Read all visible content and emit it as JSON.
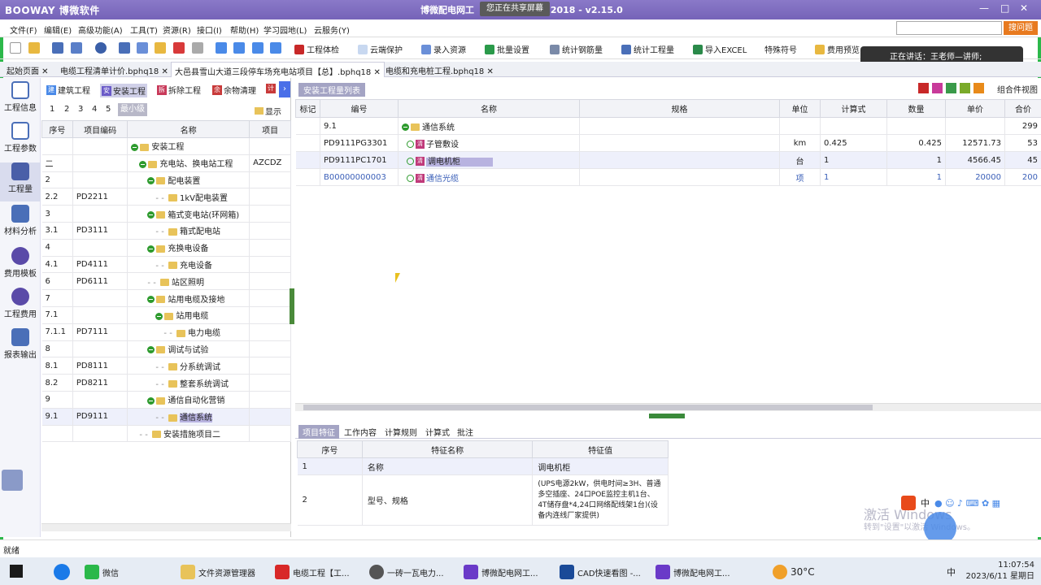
{
  "window": {
    "logo": "BOOWAY 博微软件",
    "title": "博微配电网工",
    "title_suffix": "2018 - v2.15.0",
    "share_notice": "您正在共享屏幕",
    "controls": [
      "—",
      "□",
      "✕"
    ]
  },
  "menu": {
    "items": [
      "文件(F)",
      "编辑(E)",
      "高级功能(A)",
      "工具(T)",
      "资源(R)",
      "接口(I)",
      "帮助(H)",
      "学习园地(L)",
      "云服务(Y)"
    ],
    "search_placeholder": "",
    "ask_label": "搜问题"
  },
  "toolbar": {
    "buttons": [
      "工程体检",
      "云端保护",
      "录入资源",
      "批量设置",
      "统计钢筋量",
      "统计工程量",
      "导入EXCEL",
      "特殊符号",
      "费用预览"
    ],
    "speaking": "正在讲话：王老师—讲师;"
  },
  "doc_tabs": [
    "起始页面",
    "电缆工程清单计价.bphq18",
    "大邑县雪山大道三段停车场充电站项目【总】.bphq18",
    "电缆和充电桩工程.bphq18"
  ],
  "left_nav": [
    "工程信息",
    "工程参数",
    "工程量",
    "材料分析",
    "费用模板",
    "工程费用",
    "报表输出"
  ],
  "tree_panel": {
    "subtabs": [
      "建筑工程",
      "安装工程",
      "拆除工程",
      "余物清理",
      "计"
    ],
    "subtab_icons": [
      "建",
      "安",
      "拆",
      "余",
      "计"
    ],
    "levels": [
      "1",
      "2",
      "3",
      "4",
      "5",
      "最小级"
    ],
    "display_label": "显示",
    "headers": [
      "序号",
      "项目编码",
      "名称",
      "项目"
    ],
    "rows": [
      {
        "seq": "",
        "code": "",
        "name": "安装工程",
        "extra": "",
        "depth": 0,
        "expand": true
      },
      {
        "seq": "二",
        "code": "",
        "name": "充电站、换电站工程",
        "extra": "AZCDZ",
        "depth": 1,
        "expand": true
      },
      {
        "seq": "2",
        "code": "",
        "name": "配电装置",
        "extra": "",
        "depth": 2,
        "expand": true
      },
      {
        "seq": "2.2",
        "code": "PD2211",
        "name": "1kV配电装置",
        "extra": "",
        "depth": 3,
        "expand": false
      },
      {
        "seq": "3",
        "code": "",
        "name": "箱式变电站(环网箱)",
        "extra": "",
        "depth": 2,
        "expand": true
      },
      {
        "seq": "3.1",
        "code": "PD3111",
        "name": "箱式配电站",
        "extra": "",
        "depth": 3,
        "expand": false
      },
      {
        "seq": "4",
        "code": "",
        "name": "充换电设备",
        "extra": "",
        "depth": 2,
        "expand": true
      },
      {
        "seq": "4.1",
        "code": "PD4111",
        "name": "充电设备",
        "extra": "",
        "depth": 3,
        "expand": false
      },
      {
        "seq": "6",
        "code": "PD6111",
        "name": "站区照明",
        "extra": "",
        "depth": 2,
        "expand": false
      },
      {
        "seq": "7",
        "code": "",
        "name": "站用电缆及接地",
        "extra": "",
        "depth": 2,
        "expand": true
      },
      {
        "seq": "7.1",
        "code": "",
        "name": "站用电缆",
        "extra": "",
        "depth": 3,
        "expand": true
      },
      {
        "seq": "7.1.1",
        "code": "PD7111",
        "name": "电力电缆",
        "extra": "",
        "depth": 4,
        "expand": false
      },
      {
        "seq": "8",
        "code": "",
        "name": "调试与试验",
        "extra": "",
        "depth": 2,
        "expand": true
      },
      {
        "seq": "8.1",
        "code": "PD8111",
        "name": "分系统调试",
        "extra": "",
        "depth": 3,
        "expand": false
      },
      {
        "seq": "8.2",
        "code": "PD8211",
        "name": "整套系统调试",
        "extra": "",
        "depth": 3,
        "expand": false
      },
      {
        "seq": "9",
        "code": "",
        "name": "通信自动化营销",
        "extra": "",
        "depth": 2,
        "expand": true
      },
      {
        "seq": "9.1",
        "code": "PD9111",
        "name": "通信系统",
        "extra": "",
        "depth": 3,
        "expand": false,
        "selected": true
      },
      {
        "seq": "",
        "code": "",
        "name": "安装措施项目二",
        "extra": "",
        "depth": 1,
        "expand": false
      }
    ]
  },
  "qty_panel": {
    "badge": "安装工程量列表",
    "combo_label": "组合件视图",
    "headers": [
      "标记",
      "编号",
      "名称",
      "规格",
      "单位",
      "计算式",
      "数量",
      "单价",
      "合价"
    ],
    "rows": [
      {
        "mark": "",
        "code": "9.1",
        "name": "通信系统",
        "spec": "",
        "unit": "",
        "formula": "",
        "qty": "",
        "price": "",
        "total": "299",
        "type": "group"
      },
      {
        "mark": "",
        "code": "PD9111PG3301",
        "name": "子管敷设",
        "spec": "",
        "unit": "km",
        "formula": "0.425",
        "qty": "0.425",
        "price": "12571.73",
        "total": "53",
        "type": "item"
      },
      {
        "mark": "",
        "code": "PD9111PC1701",
        "name": "调电机柜",
        "spec": "",
        "unit": "台",
        "formula": "1",
        "qty": "1",
        "price": "4566.45",
        "total": "45",
        "type": "item",
        "selected": true
      },
      {
        "mark": "",
        "code": "B00000000003",
        "name": "通信光缆",
        "spec": "",
        "unit": "项",
        "formula": "1",
        "qty": "1",
        "price": "20000",
        "total": "200",
        "type": "item",
        "blue": true
      }
    ]
  },
  "bottom_tabs": [
    "项目特征",
    "工作内容",
    "计算规则",
    "计算式",
    "批注"
  ],
  "features": {
    "headers": [
      "序号",
      "特征名称",
      "特征值"
    ],
    "rows": [
      {
        "seq": "1",
        "name": "名称",
        "value": "调电机柜"
      },
      {
        "seq": "2",
        "name": "型号、规格",
        "value": "(UPS电源2kW，供电时间≥3H、普通多空插座、24口POE监控主机1台、4T储存盘*4,24口网络配线架1台)(设备内连线厂家提供)"
      }
    ]
  },
  "status": "就绪",
  "watermark": {
    "line1": "激活 Windows",
    "line2": "转到\"设置\"以激活 Windows。"
  },
  "ime": "中",
  "taskbar": {
    "items": [
      "微信",
      "文件资源管理器",
      "电缆工程【工...",
      "一砖一瓦电力...",
      "博微配电网工...",
      "CAD快速看图 -...",
      "博微配电网工..."
    ],
    "weather": "30°C",
    "lang": "中",
    "time": "11:07:54",
    "date": "2023/6/11 星期日"
  }
}
